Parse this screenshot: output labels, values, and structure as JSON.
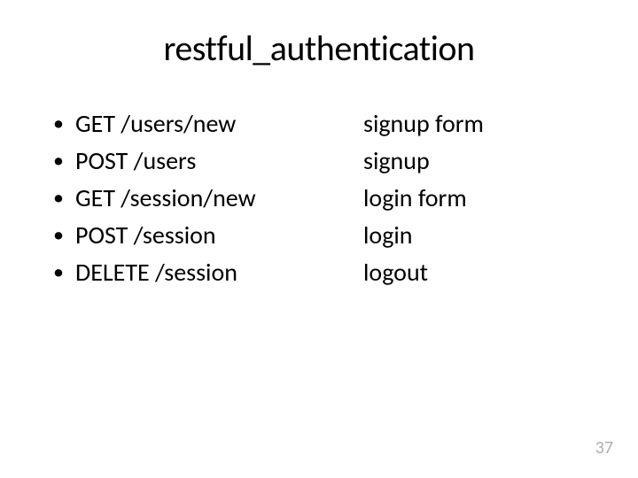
{
  "title": "restful_authentication",
  "routes": [
    {
      "request": "GET /users/new",
      "description": "signup form"
    },
    {
      "request": "POST /users",
      "description": "signup"
    },
    {
      "request": "GET /session/new",
      "description": "login form"
    },
    {
      "request": "POST /session",
      "description": "login"
    },
    {
      "request": "DELETE /session",
      "description": "logout"
    }
  ],
  "page_number": "37"
}
